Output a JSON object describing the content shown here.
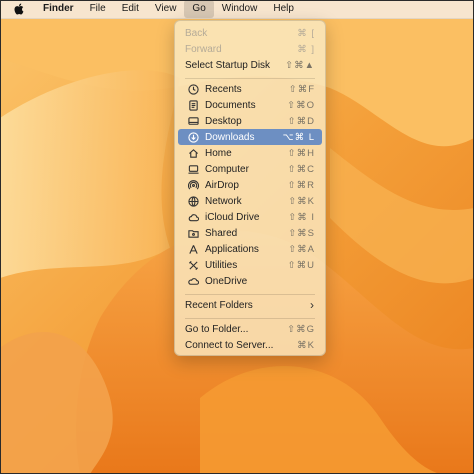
{
  "menubar": {
    "app": "Finder",
    "items": [
      "File",
      "Edit",
      "View",
      "Go",
      "Window",
      "Help"
    ]
  },
  "go_menu": {
    "back": {
      "label": "Back",
      "shortcut": "⌘ ["
    },
    "forward": {
      "label": "Forward",
      "shortcut": "⌘ ]"
    },
    "startup": {
      "label": "Select Startup Disk",
      "shortcut": "⇧⌘▲"
    },
    "places": [
      {
        "label": "Recents",
        "shortcut": "⇧⌘F",
        "icon": "clock-icon"
      },
      {
        "label": "Documents",
        "shortcut": "⇧⌘O",
        "icon": "document-icon"
      },
      {
        "label": "Desktop",
        "shortcut": "⇧⌘D",
        "icon": "desktop-icon"
      },
      {
        "label": "Downloads",
        "shortcut": "⌥⌘ L",
        "icon": "download-icon"
      },
      {
        "label": "Home",
        "shortcut": "⇧⌘H",
        "icon": "home-icon"
      },
      {
        "label": "Computer",
        "shortcut": "⇧⌘C",
        "icon": "computer-icon"
      },
      {
        "label": "AirDrop",
        "shortcut": "⇧⌘R",
        "icon": "airdrop-icon"
      },
      {
        "label": "Network",
        "shortcut": "⇧⌘K",
        "icon": "network-icon"
      },
      {
        "label": "iCloud Drive",
        "shortcut": "⇧⌘ I",
        "icon": "cloud-icon"
      },
      {
        "label": "Shared",
        "shortcut": "⇧⌘S",
        "icon": "shared-folder-icon"
      },
      {
        "label": "Applications",
        "shortcut": "⇧⌘A",
        "icon": "applications-icon"
      },
      {
        "label": "Utilities",
        "shortcut": "⇧⌘U",
        "icon": "utilities-icon"
      },
      {
        "label": "OneDrive",
        "shortcut": "",
        "icon": "onedrive-cloud-icon"
      }
    ],
    "recent_folders": {
      "label": "Recent Folders",
      "arrow": "›"
    },
    "go_to_folder": {
      "label": "Go to Folder...",
      "shortcut": "⇧⌘G"
    },
    "connect_server": {
      "label": "Connect to Server...",
      "shortcut": "⌘K"
    }
  },
  "colors": {
    "selection": "#6d8fc2",
    "wallpaper_primary": "#f49a2e",
    "wallpaper_light": "#fcd28a"
  }
}
